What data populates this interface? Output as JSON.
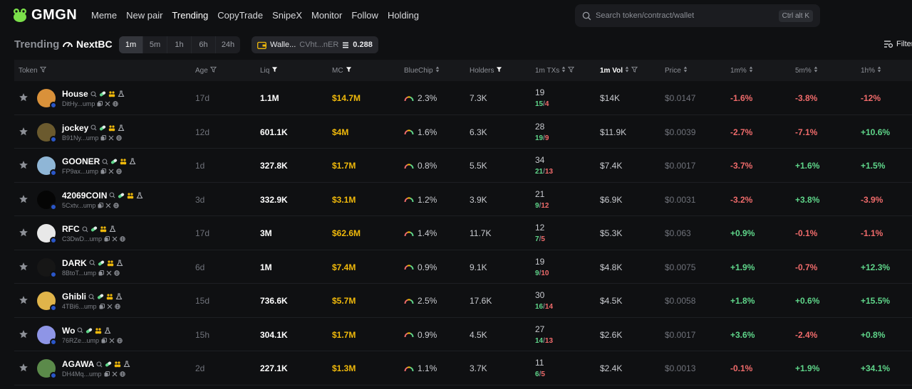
{
  "brand": {
    "name": "GMGN"
  },
  "nav": [
    "Meme",
    "New pair",
    "Trending",
    "CopyTrade",
    "SnipeX",
    "Monitor",
    "Follow",
    "Holding"
  ],
  "nav_active": "Trending",
  "search": {
    "placeholder": "Search token/contract/wallet",
    "shortcut": "Ctrl alt K"
  },
  "subbar": {
    "title": "Trending",
    "chain_label": "NextBC",
    "timeframes": [
      "1m",
      "5m",
      "1h",
      "6h",
      "24h"
    ],
    "active_timeframe": "1m",
    "wallet": {
      "name": "Walle...",
      "address": "CVht...nER",
      "balance": "0.288"
    },
    "filter_label": "Filter"
  },
  "columns": {
    "token": "Token",
    "age": "Age",
    "liq": "Liq",
    "mc": "MC",
    "bluechip": "BlueChip",
    "holders": "Holders",
    "txs": "1m TXs",
    "vol": "1m Vol",
    "price": "Price",
    "c1m": "1m%",
    "c5m": "5m%",
    "c1h": "1h%"
  },
  "colors": {
    "accent_yellow": "#f0b90b",
    "positive": "#5fd68a",
    "negative": "#f06b6b",
    "background": "#0f1012"
  },
  "rows": [
    {
      "name": "House",
      "addr": "DitHy...ump",
      "age": "17d",
      "liq": "1.1M",
      "mc": "$14.7M",
      "bluechip": "2.3%",
      "holders": "7.3K",
      "txs": "19",
      "buys": "15",
      "sells": "4",
      "vol": "$14K",
      "price": "$0.0147",
      "c1m": "-1.6%",
      "c5m": "-3.8%",
      "c1h": "-12%",
      "avatar_color": "#d9913a"
    },
    {
      "name": "jockey",
      "addr": "B91Ny...ump",
      "age": "12d",
      "liq": "601.1K",
      "mc": "$4M",
      "bluechip": "1.6%",
      "holders": "6.3K",
      "txs": "28",
      "buys": "19",
      "sells": "9",
      "vol": "$11.9K",
      "price": "$0.0039",
      "c1m": "-2.7%",
      "c5m": "-7.1%",
      "c1h": "+10.6%",
      "avatar_color": "#6b5a2e"
    },
    {
      "name": "GOONER",
      "addr": "FP9ax...ump",
      "age": "1d",
      "liq": "327.8K",
      "mc": "$1.7M",
      "bluechip": "0.8%",
      "holders": "5.5K",
      "txs": "34",
      "buys": "21",
      "sells": "13",
      "vol": "$7.4K",
      "price": "$0.0017",
      "c1m": "-3.7%",
      "c5m": "+1.6%",
      "c1h": "+1.5%",
      "avatar_color": "#8fb6d6"
    },
    {
      "name": "42069COIN",
      "addr": "5Cxtv...ump",
      "age": "3d",
      "liq": "332.9K",
      "mc": "$3.1M",
      "bluechip": "1.2%",
      "holders": "3.9K",
      "txs": "21",
      "buys": "9",
      "sells": "12",
      "vol": "$6.9K",
      "price": "$0.0031",
      "c1m": "-3.2%",
      "c5m": "+3.8%",
      "c1h": "-3.9%",
      "avatar_color": "#050505"
    },
    {
      "name": "RFC",
      "addr": "C3DwD...ump",
      "age": "17d",
      "liq": "3M",
      "mc": "$62.6M",
      "bluechip": "1.4%",
      "holders": "11.7K",
      "txs": "12",
      "buys": "7",
      "sells": "5",
      "vol": "$5.3K",
      "price": "$0.063",
      "c1m": "+0.9%",
      "c5m": "-0.1%",
      "c1h": "-1.1%",
      "avatar_color": "#e8e8e8"
    },
    {
      "name": "DARK",
      "addr": "8BtoT...ump",
      "age": "6d",
      "liq": "1M",
      "mc": "$7.4M",
      "bluechip": "0.9%",
      "holders": "9.1K",
      "txs": "19",
      "buys": "9",
      "sells": "10",
      "vol": "$4.8K",
      "price": "$0.0075",
      "c1m": "+1.9%",
      "c5m": "-0.7%",
      "c1h": "+12.3%",
      "avatar_color": "#161616"
    },
    {
      "name": "Ghibli",
      "addr": "4TBi6...ump",
      "age": "15d",
      "liq": "736.6K",
      "mc": "$5.7M",
      "bluechip": "2.5%",
      "holders": "17.6K",
      "txs": "30",
      "buys": "16",
      "sells": "14",
      "vol": "$4.5K",
      "price": "$0.0058",
      "c1m": "+1.8%",
      "c5m": "+0.6%",
      "c1h": "+15.5%",
      "avatar_color": "#e0b44a"
    },
    {
      "name": "Wo",
      "addr": "76RZe...ump",
      "age": "15h",
      "liq": "304.1K",
      "mc": "$1.7M",
      "bluechip": "0.9%",
      "holders": "4.5K",
      "txs": "27",
      "buys": "14",
      "sells": "13",
      "vol": "$2.6K",
      "price": "$0.0017",
      "c1m": "+3.6%",
      "c5m": "-2.4%",
      "c1h": "+0.8%",
      "avatar_color": "#8e95e6"
    },
    {
      "name": "AGAWA",
      "addr": "DH4Mq...ump",
      "age": "2d",
      "liq": "227.1K",
      "mc": "$1.3M",
      "bluechip": "1.1%",
      "holders": "3.7K",
      "txs": "11",
      "buys": "6",
      "sells": "5",
      "vol": "$2.4K",
      "price": "$0.0013",
      "c1m": "-0.1%",
      "c5m": "+1.9%",
      "c1h": "+34.1%",
      "avatar_color": "#5b8a4a"
    }
  ]
}
